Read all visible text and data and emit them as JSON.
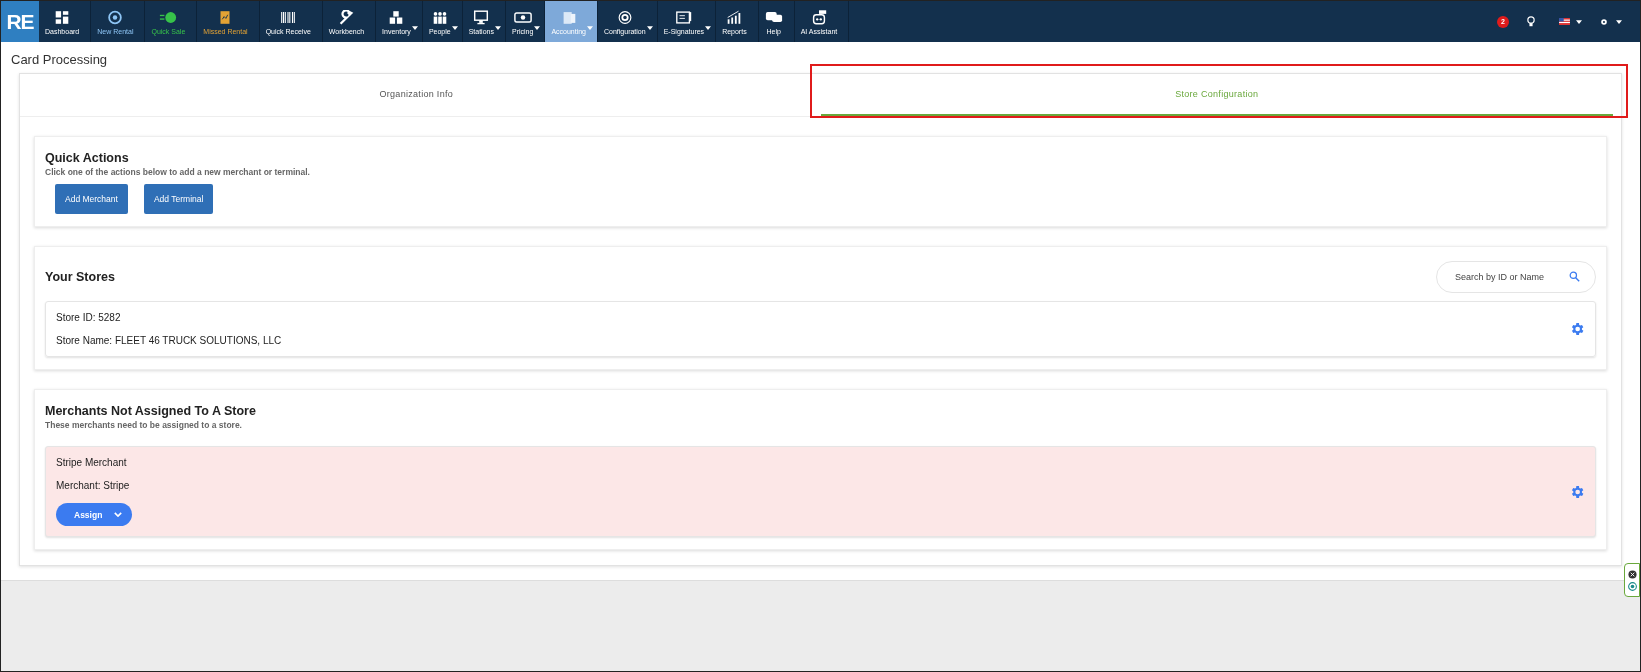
{
  "nav": {
    "logo": "RE",
    "items": [
      {
        "label": "Dashboard",
        "kind": "plain",
        "dropdown": false,
        "selected": false
      },
      {
        "label": "New Rental",
        "kind": "rental",
        "dropdown": false,
        "selected": false
      },
      {
        "label": "Quick Sale",
        "kind": "sale",
        "dropdown": false,
        "selected": false
      },
      {
        "label": "Missed Rental",
        "kind": "missed",
        "dropdown": false,
        "selected": false
      },
      {
        "label": "Quick Receive",
        "kind": "plain",
        "dropdown": false,
        "selected": false
      },
      {
        "label": "Workbench",
        "kind": "plain",
        "dropdown": false,
        "selected": false
      },
      {
        "label": "Inventory",
        "kind": "plain",
        "dropdown": true,
        "selected": false
      },
      {
        "label": "People",
        "kind": "plain",
        "dropdown": true,
        "selected": false
      },
      {
        "label": "Stations",
        "kind": "plain",
        "dropdown": true,
        "selected": false
      },
      {
        "label": "Pricing",
        "kind": "plain",
        "dropdown": true,
        "selected": false
      },
      {
        "label": "Accounting",
        "kind": "plain",
        "dropdown": true,
        "selected": true
      },
      {
        "label": "Configuration",
        "kind": "plain",
        "dropdown": true,
        "selected": false
      },
      {
        "label": "E-Signatures",
        "kind": "plain",
        "dropdown": true,
        "selected": false
      },
      {
        "label": "Reports",
        "kind": "plain",
        "dropdown": false,
        "selected": false
      },
      {
        "label": "Help",
        "kind": "plain",
        "dropdown": false,
        "selected": false
      },
      {
        "label": "AI Assistant",
        "kind": "plain",
        "dropdown": false,
        "selected": false
      }
    ],
    "notification_count": "2"
  },
  "page_title": "Card Processing",
  "tabs": [
    {
      "label": "Organization Info",
      "selected": false
    },
    {
      "label": "Store Configuration",
      "selected": true
    }
  ],
  "highlight_box": true,
  "quick_actions": {
    "title": "Quick Actions",
    "subtitle": "Click one of the actions below to add a new merchant or terminal.",
    "buttons": [
      "Add Merchant",
      "Add Terminal"
    ]
  },
  "your_stores": {
    "title": "Your Stores",
    "search": {
      "placeholder": "Search by ID or Name"
    },
    "stores": [
      {
        "id_line": "Store ID: 5282",
        "name_line": "Store Name: FLEET 46 TRUCK SOLUTIONS, LLC"
      }
    ]
  },
  "unassigned": {
    "title": "Merchants Not Assigned To A Store",
    "subtitle": "These merchants need to be assigned to a store.",
    "merchants": [
      {
        "name": "Stripe Merchant",
        "detail": "Merchant: Stripe",
        "action": "Assign"
      }
    ]
  }
}
